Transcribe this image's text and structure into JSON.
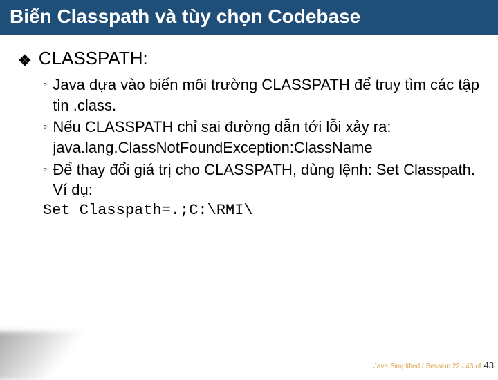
{
  "title": "Biến Classpath và tùy chọn Codebase",
  "heading": "CLASSPATH:",
  "items": [
    "Java dựa vào biến môi trường CLASSPATH để truy tìm các tập tin .class.",
    "Nếu CLASSPATH chỉ sai đường dẫn tới lỗi xảy ra: java.lang.ClassNotFoundException:ClassName",
    "Để thay đổi giá trị cho CLASSPATH, dùng lệnh: Set Classpath. Ví dụ:"
  ],
  "code": "Set Classpath=.;C:\\RMI\\",
  "footer_text": "Java Simplified / Session 22 / 43 of",
  "page_number": "43"
}
